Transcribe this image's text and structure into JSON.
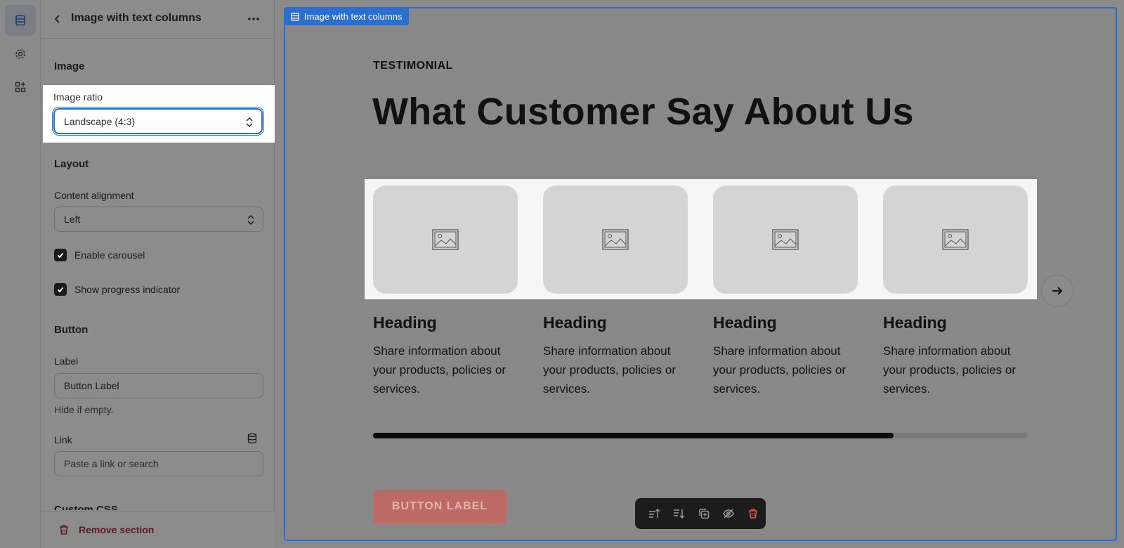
{
  "panel": {
    "title": "Image with text columns",
    "image_section": "Image",
    "image_ratio_label": "Image ratio",
    "image_ratio_value": "Landscape (4:3)",
    "layout_section": "Layout",
    "content_alignment_label": "Content alignment",
    "content_alignment_value": "Left",
    "enable_carousel": "Enable carousel",
    "show_progress": "Show progress indicator",
    "button_section": "Button",
    "label_label": "Label",
    "label_value": "Button Label",
    "label_help": "Hide if empty.",
    "link_label": "Link",
    "link_placeholder": "Paste a link or search",
    "custom_css_section": "Custom CSS",
    "remove_section": "Remove section"
  },
  "preview": {
    "section_tag": "Image with text columns",
    "eyebrow": "TESTIMONIAL",
    "title": "What Customer Say About Us",
    "cards": [
      {
        "heading": "Heading",
        "text": "Share information about your products, policies or services."
      },
      {
        "heading": "Heading",
        "text": "Share information about your products, policies or services."
      },
      {
        "heading": "Heading",
        "text": "Share information about your products, policies or services."
      },
      {
        "heading": "Heading",
        "text": "Share information about your products, policies or services."
      }
    ],
    "progress_fraction": 0.795,
    "button_label": "BUTTON LABEL"
  },
  "colors": {
    "accent": "#2c6ecb",
    "cta": "#bd6a66",
    "danger": "#e05a4f"
  },
  "icons": {
    "rail": [
      "sections-icon",
      "gear-icon",
      "apps-icon"
    ],
    "toolbar": [
      "move-up-icon",
      "move-down-icon",
      "duplicate-icon",
      "hide-icon",
      "delete-icon"
    ]
  }
}
